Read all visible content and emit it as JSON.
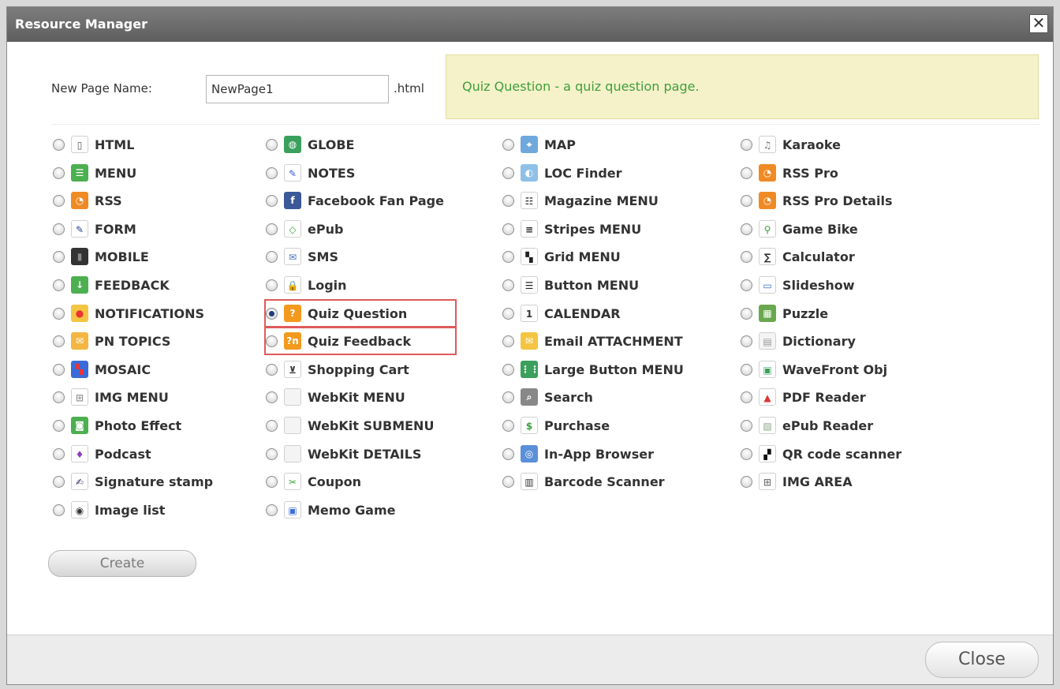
{
  "dialog": {
    "title": "Resource Manager",
    "close_glyph": "✕"
  },
  "form": {
    "name_label": "New Page Name:",
    "name_value": "NewPage1",
    "extension": ".html"
  },
  "description": "Quiz Question - a quiz question page.",
  "columns": [
    {
      "items": [
        {
          "label": "HTML",
          "icon": "html-page-icon",
          "color": "#ffffff",
          "glyph": "▯",
          "fg": "#555"
        },
        {
          "label": "MENU",
          "icon": "menu-icon",
          "color": "#4caf50",
          "glyph": "☰",
          "fg": "#fff"
        },
        {
          "label": "RSS",
          "icon": "rss-icon",
          "color": "#f08a24",
          "glyph": "◔",
          "fg": "#fff"
        },
        {
          "label": "FORM",
          "icon": "pencil-icon",
          "color": "#ffffff",
          "glyph": "✎",
          "fg": "#2a3f8a"
        },
        {
          "label": "MOBILE",
          "icon": "phone-icon",
          "color": "#333333",
          "glyph": "▮",
          "fg": "#888"
        },
        {
          "label": "FEEDBACK",
          "icon": "feedback-icon",
          "color": "#4caf50",
          "glyph": "↓",
          "fg": "#fff"
        },
        {
          "label": "NOTIFICATIONS",
          "icon": "notification-icon",
          "color": "#f4c542",
          "glyph": "●",
          "fg": "#e33"
        },
        {
          "label": "PN TOPICS",
          "icon": "pn-topics-icon",
          "color": "#f4b642",
          "glyph": "✉",
          "fg": "#fff"
        },
        {
          "label": "MOSAIC",
          "icon": "mosaic-icon",
          "color": "#3a6bd8",
          "glyph": "▚",
          "fg": "#e33"
        },
        {
          "label": "IMG MENU",
          "icon": "image-menu-icon",
          "color": "#ffffff",
          "glyph": "⊞",
          "fg": "#999"
        },
        {
          "label": "Photo Effect",
          "icon": "camera-icon",
          "color": "#4caf50",
          "glyph": "◙",
          "fg": "#fff"
        },
        {
          "label": "Podcast",
          "icon": "podcast-icon",
          "color": "#ffffff",
          "glyph": "♦",
          "fg": "#8a3fbf"
        },
        {
          "label": "Signature stamp",
          "icon": "stamp-icon",
          "color": "#ffffff",
          "glyph": "✍",
          "fg": "#336"
        },
        {
          "label": "Image list",
          "icon": "image-list-icon",
          "color": "#ffffff",
          "glyph": "◉",
          "fg": "#333"
        }
      ]
    },
    {
      "items": [
        {
          "label": "GLOBE",
          "icon": "globe-icon",
          "color": "#3aa05c",
          "glyph": "◍",
          "fg": "#fff"
        },
        {
          "label": "NOTES",
          "icon": "notes-icon",
          "color": "#ffffff",
          "glyph": "✎",
          "fg": "#3b5bd8"
        },
        {
          "label": "Facebook Fan Page",
          "icon": "facebook-icon",
          "color": "#3b5998",
          "glyph": "f",
          "fg": "#fff"
        },
        {
          "label": "ePub",
          "icon": "epub-icon",
          "color": "#ffffff",
          "glyph": "◇",
          "fg": "#3aa03a"
        },
        {
          "label": "SMS",
          "icon": "envelope-icon",
          "color": "#ffffff",
          "glyph": "✉",
          "fg": "#4a6fbf"
        },
        {
          "label": "Login",
          "icon": "lock-icon",
          "color": "#ffffff",
          "glyph": "🔒",
          "fg": "#c90"
        },
        {
          "label": "Quiz Question",
          "icon": "quiz-question-icon",
          "color": "#f39a1e",
          "glyph": "?",
          "fg": "#fff",
          "selected": true,
          "highlight": true
        },
        {
          "label": "Quiz Feedback",
          "icon": "quiz-feedback-icon",
          "color": "#f39a1e",
          "glyph": "?n",
          "fg": "#fff",
          "highlight": true
        },
        {
          "label": "Shopping Cart",
          "icon": "cart-icon",
          "color": "#ffffff",
          "glyph": "⊻",
          "fg": "#333"
        },
        {
          "label": "WebKit MENU",
          "icon": "webkit-menu-icon",
          "color": "#f4f4f4",
          "glyph": "",
          "fg": "#999"
        },
        {
          "label": "WebKit SUBMENU",
          "icon": "webkit-submenu-icon",
          "color": "#f4f4f4",
          "glyph": "",
          "fg": "#999"
        },
        {
          "label": "WebKit DETAILS",
          "icon": "webkit-details-icon",
          "color": "#f4f4f4",
          "glyph": "",
          "fg": "#999"
        },
        {
          "label": "Coupon",
          "icon": "scissors-icon",
          "color": "#ffffff",
          "glyph": "✂",
          "fg": "#3aa03a"
        },
        {
          "label": "Memo Game",
          "icon": "memo-game-icon",
          "color": "#ffffff",
          "glyph": "▣",
          "fg": "#3b6bd8"
        }
      ]
    },
    {
      "items": [
        {
          "label": "MAP",
          "icon": "map-icon",
          "color": "#6fa8dc",
          "glyph": "⌖",
          "fg": "#fff"
        },
        {
          "label": "LOC Finder",
          "icon": "location-icon",
          "color": "#8fc1e8",
          "glyph": "◐",
          "fg": "#fff"
        },
        {
          "label": "Magazine MENU",
          "icon": "magazine-menu-icon",
          "color": "#ffffff",
          "glyph": "☷",
          "fg": "#222"
        },
        {
          "label": "Stripes MENU",
          "icon": "stripes-menu-icon",
          "color": "#ffffff",
          "glyph": "≡",
          "fg": "#222"
        },
        {
          "label": "Grid MENU",
          "icon": "grid-menu-icon",
          "color": "#ffffff",
          "glyph": "▚",
          "fg": "#222"
        },
        {
          "label": "Button MENU",
          "icon": "button-menu-icon",
          "color": "#ffffff",
          "glyph": "☰",
          "fg": "#222"
        },
        {
          "label": "CALENDAR",
          "icon": "calendar-icon",
          "color": "#ffffff",
          "glyph": "1",
          "fg": "#333"
        },
        {
          "label": "Email ATTACHMENT",
          "icon": "email-attachment-icon",
          "color": "#f4c542",
          "glyph": "✉",
          "fg": "#fff"
        },
        {
          "label": "Large Button MENU",
          "icon": "large-button-menu-icon",
          "color": "#3aa05c",
          "glyph": "⋮⋮",
          "fg": "#fff"
        },
        {
          "label": "Search",
          "icon": "search-icon",
          "color": "#888888",
          "glyph": "⌕",
          "fg": "#fff"
        },
        {
          "label": "Purchase",
          "icon": "purchase-icon",
          "color": "#ffffff",
          "glyph": "$",
          "fg": "#3aa03a"
        },
        {
          "label": "In-App Browser",
          "icon": "browser-icon",
          "color": "#5b8fd8",
          "glyph": "◎",
          "fg": "#fff"
        },
        {
          "label": "Barcode Scanner",
          "icon": "barcode-icon",
          "color": "#ffffff",
          "glyph": "▥",
          "fg": "#333"
        }
      ]
    },
    {
      "items": [
        {
          "label": "Karaoke",
          "icon": "microphone-icon",
          "color": "#ffffff",
          "glyph": "♫",
          "fg": "#777"
        },
        {
          "label": "RSS Pro",
          "icon": "rss-pro-icon",
          "color": "#f08a24",
          "glyph": "◔",
          "fg": "#fff"
        },
        {
          "label": "RSS Pro Details",
          "icon": "rss-pro-details-icon",
          "color": "#f08a24",
          "glyph": "◔",
          "fg": "#fff"
        },
        {
          "label": "Game Bike",
          "icon": "bike-icon",
          "color": "#ffffff",
          "glyph": "⚲",
          "fg": "#3aa03a"
        },
        {
          "label": "Calculator",
          "icon": "sigma-icon",
          "color": "#ffffff",
          "glyph": "∑",
          "fg": "#333"
        },
        {
          "label": "Slideshow",
          "icon": "slideshow-icon",
          "color": "#ffffff",
          "glyph": "▭",
          "fg": "#3b6bd8"
        },
        {
          "label": "Puzzle",
          "icon": "puzzle-icon",
          "color": "#6aa84f",
          "glyph": "▦",
          "fg": "#fff"
        },
        {
          "label": "Dictionary",
          "icon": "dictionary-icon",
          "color": "#f4f4f4",
          "glyph": "▤",
          "fg": "#999"
        },
        {
          "label": "WaveFront Obj",
          "icon": "wavefront-icon",
          "color": "#ffffff",
          "glyph": "▣",
          "fg": "#3aa05c"
        },
        {
          "label": "PDF Reader",
          "icon": "pdf-icon",
          "color": "#ffffff",
          "glyph": "▲",
          "fg": "#d33"
        },
        {
          "label": "ePub Reader",
          "icon": "epub-reader-icon",
          "color": "#ffffff",
          "glyph": "▨",
          "fg": "#8a8"
        },
        {
          "label": "QR code scanner",
          "icon": "qr-code-icon",
          "color": "#ffffff",
          "glyph": "▞",
          "fg": "#111"
        },
        {
          "label": "IMG AREA",
          "icon": "image-area-icon",
          "color": "#ffffff",
          "glyph": "⊞",
          "fg": "#777"
        }
      ]
    }
  ],
  "buttons": {
    "create": "Create",
    "close": "Close"
  }
}
